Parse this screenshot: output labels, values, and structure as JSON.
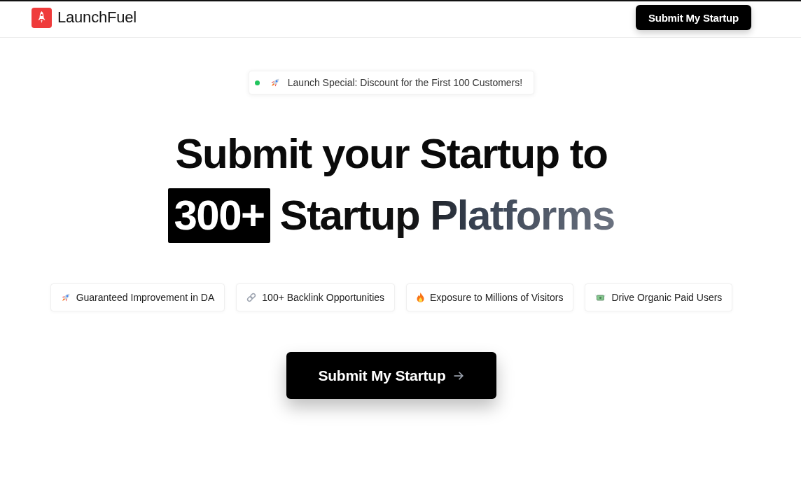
{
  "header": {
    "brand": "LaunchFuel",
    "button": "Submit My Startup"
  },
  "announcement": {
    "text": "Launch Special: Discount for the First 100 Customers!"
  },
  "hero": {
    "title_line_1": "Submit your Startup to",
    "highlight": "300+",
    "title_line_2": "Startup Platforms"
  },
  "features": [
    {
      "text": "Guaranteed Improvement in DA"
    },
    {
      "text": "100+ Backlink Opportunities"
    },
    {
      "text": "Exposure to Millions of Visitors"
    },
    {
      "text": "Drive Organic Paid Users"
    }
  ],
  "cta": {
    "label": "Submit My Startup"
  }
}
